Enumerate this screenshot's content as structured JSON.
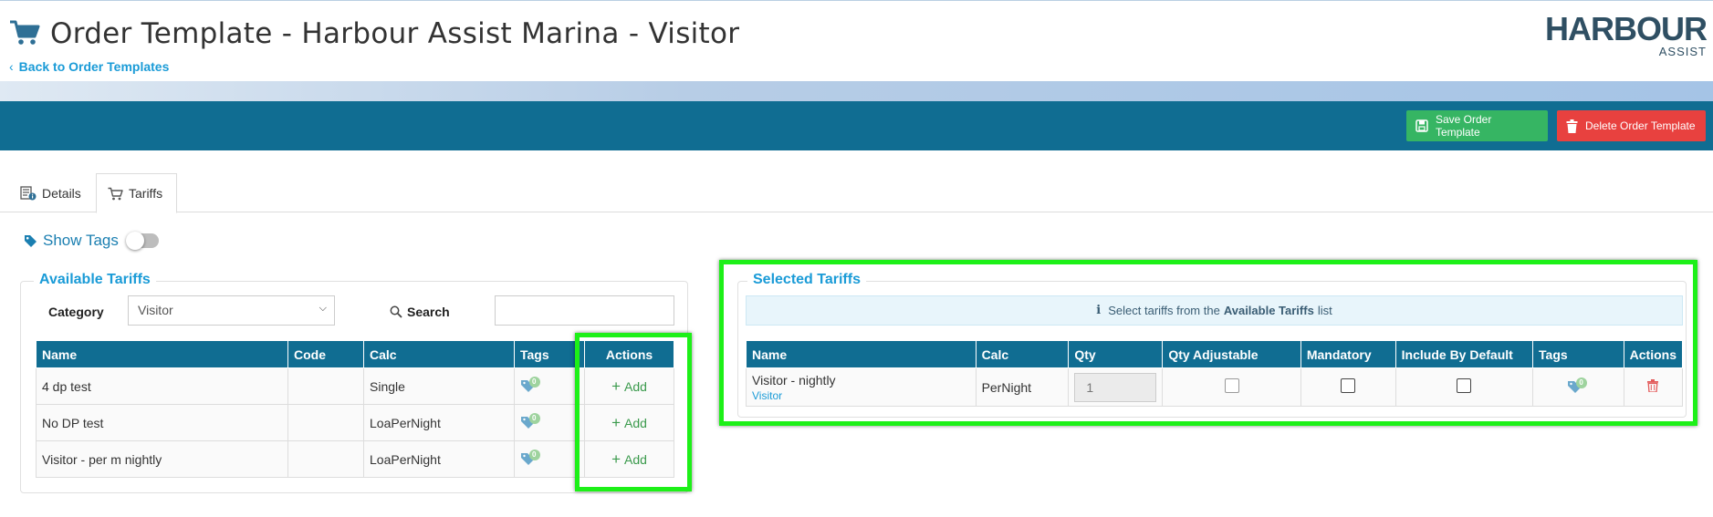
{
  "header": {
    "title": "Order Template - Harbour Assist Marina - Visitor",
    "back_link": "Back to Order Templates",
    "logo_main": "HARBOUR",
    "logo_sub": "ASSIST"
  },
  "toolbar": {
    "save_label": "Save Order Template",
    "delete_label": "Delete Order Template"
  },
  "tabs": [
    {
      "label": "Details"
    },
    {
      "label": "Tariffs",
      "active": true
    }
  ],
  "show_tags": {
    "label": "Show Tags",
    "enabled": false
  },
  "available": {
    "legend": "Available Tariffs",
    "category_label": "Category",
    "category_value": "Visitor",
    "search_label": "Search",
    "search_value": "",
    "columns": [
      "Name",
      "Code",
      "Calc",
      "Tags",
      "Actions"
    ],
    "rows": [
      {
        "name": "4 dp test",
        "code": "",
        "calc": "Single",
        "tag_count": "0",
        "action": "Add"
      },
      {
        "name": "No DP test",
        "code": "",
        "calc": "LoaPerNight",
        "tag_count": "0",
        "action": "Add"
      },
      {
        "name": "Visitor - per m nightly",
        "code": "",
        "calc": "LoaPerNight",
        "tag_count": "0",
        "action": "Add"
      }
    ]
  },
  "selected": {
    "legend": "Selected Tariffs",
    "info_prefix": "Select tariffs from the",
    "info_bold": "Available Tariffs",
    "info_suffix": "list",
    "columns": [
      "Name",
      "Calc",
      "Qty",
      "Qty Adjustable",
      "Mandatory",
      "Include By Default",
      "Tags",
      "Actions"
    ],
    "rows": [
      {
        "name": "Visitor - nightly",
        "category": "Visitor",
        "calc": "PerNight",
        "qty": "1",
        "qty_adjustable": false,
        "mandatory": false,
        "include_by_default": false,
        "tag_count": "0"
      }
    ]
  },
  "colors": {
    "primary": "#106d92",
    "accent_link": "#1a9bd7",
    "save": "#36b563",
    "delete": "#e8413f",
    "highlight": "#1df018"
  }
}
